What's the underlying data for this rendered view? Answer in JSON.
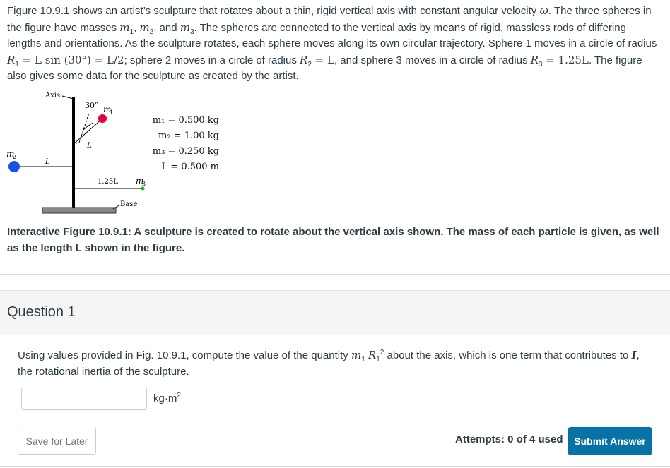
{
  "intro": {
    "line1": "Figure 10.9.1 shows an artist’s sculpture that rotates about a thin, rigid vertical axis with constant angular velocity ",
    "omega": "ω",
    "line1b": ". The three spheres in the figure have masses ",
    "m": "m",
    "s1": "1",
    "s2": "2",
    "s3": "3",
    "comma": ", ",
    "and": ", and ",
    "line2": ". The spheres are connected to the vertical axis by means of rigid, massless rods of differing lengths and orientations. As the sculpture rotates, each sphere moves along its own circular trajectory. Sphere 1 moves in a circle of radius ",
    "R": "R",
    "r1expr": " = L sin (30°) = L/2",
    "r1rest": "; sphere 2 moves in a circle of radius ",
    "r2expr": " = L",
    "r2rest": ", and sphere 3 moves in a circle of radius ",
    "r3expr": " = 1.25L",
    "end": ". The figure also gives some data for the sculpture as created by the artist."
  },
  "figure": {
    "axis_label": "Axis",
    "angle_label": "30°",
    "m1_label": "m",
    "m1_sub": "1",
    "m2_label": "m",
    "m2_sub": "2",
    "m3_label": "m",
    "m3_sub": "3",
    "L_label_rod1": "L",
    "L_label_rod2": "L",
    "rod3_label": "1.25L",
    "base_label": "Base",
    "data": [
      "m₁ = 0.500 kg",
      "m₂ = 1.00 kg",
      "m₃ = 0.250 kg",
      "L = 0.500 m"
    ],
    "colors": {
      "m1": "#e8003a",
      "m2": "#1a4fe6",
      "m3": "#22aa22",
      "base": "#888888"
    }
  },
  "caption": "Interactive Figure 10.9.1: A sculpture is created to rotate about the vertical axis shown. The mass of each particle is given, as well as the length L shown in the figure.",
  "question": {
    "title": "Question 1",
    "text_a": "Using values provided in Fig. 10.9.1, compute the value of the quantity ",
    "text_b": " about the axis, which is one term that contributes to ",
    "I": "I",
    "text_c": ", the rotational inertia of the sculpture.",
    "answer_value": "",
    "unit": "kg·m",
    "unit_sup": "2"
  },
  "footer": {
    "save_label": "Save for Later",
    "attempts": "Attempts: 0 of 4 used",
    "submit_label": "Submit Answer"
  }
}
